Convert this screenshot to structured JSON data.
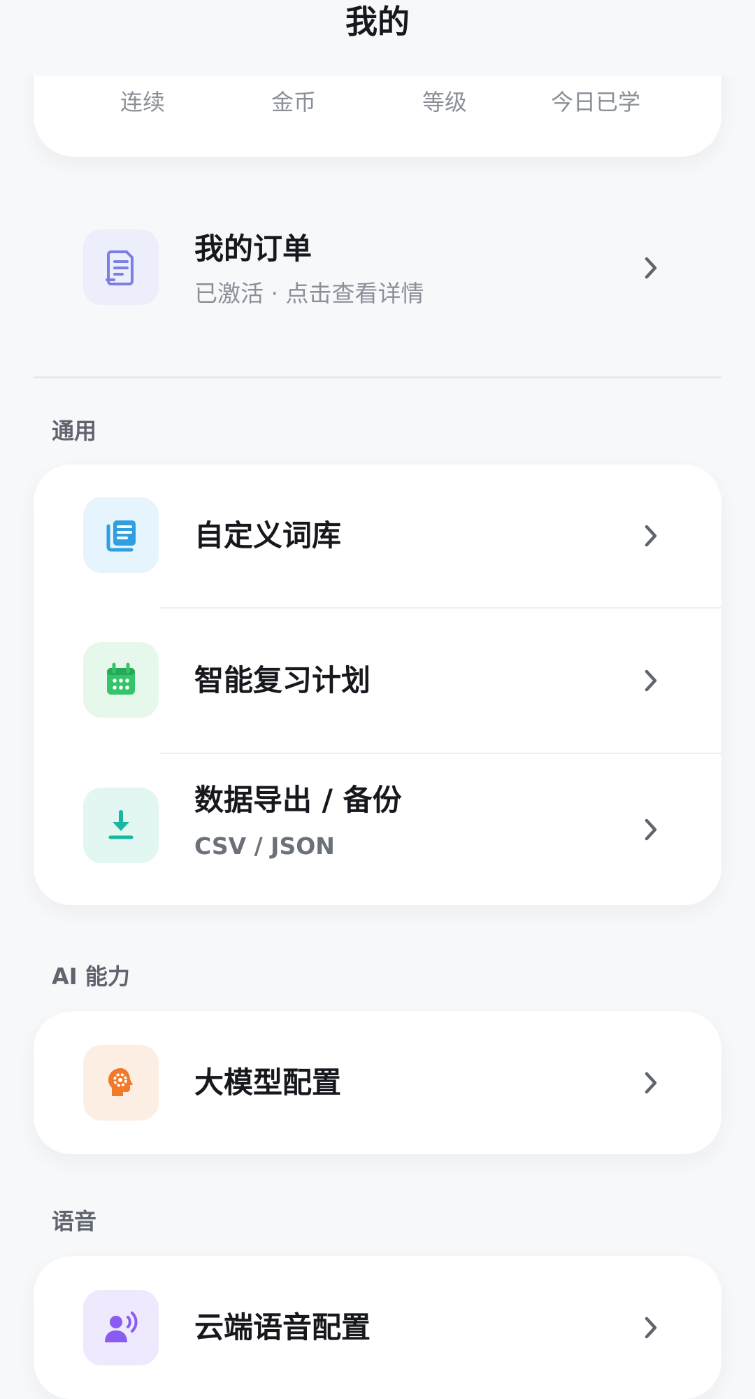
{
  "header": {
    "title": "我的"
  },
  "stats": {
    "labels": [
      "连续",
      "金币",
      "等级",
      "今日已学"
    ]
  },
  "order": {
    "title": "我的订单",
    "subtitle": "已激活 · 点击查看详情",
    "icon": "receipt-icon",
    "icon_bg": "#eceefc",
    "icon_color": "#7b7fe0"
  },
  "sections": {
    "general": {
      "label": "通用",
      "items": [
        {
          "title": "自定义词库",
          "icon": "book-list-icon",
          "icon_bg": "#e5f4fd",
          "icon_color": "#2f9fe0"
        },
        {
          "title": "智能复习计划",
          "icon": "calendar-icon",
          "icon_bg": "#e6f7ec",
          "icon_color": "#34c46a"
        },
        {
          "title": "数据导出 / 备份",
          "subtitle": "CSV / JSON",
          "icon": "download-icon",
          "icon_bg": "#e2f6f2",
          "icon_color": "#19b7a2"
        }
      ]
    },
    "ai": {
      "label": "AI 能力",
      "items": [
        {
          "title": "大模型配置",
          "icon": "brain-gear-icon",
          "icon_bg": "#fdeee4",
          "icon_color": "#f07a2a"
        }
      ]
    },
    "voice": {
      "label": "语音",
      "items": [
        {
          "title": "云端语音配置",
          "icon": "voice-user-icon",
          "icon_bg": "#efe9fd",
          "icon_color": "#8a5cf0"
        }
      ]
    }
  },
  "colors": {
    "background": "#f7f8fa",
    "card": "#ffffff",
    "text_primary": "#16181d",
    "text_secondary": "#8a8f98",
    "chevron": "#5f646d"
  }
}
